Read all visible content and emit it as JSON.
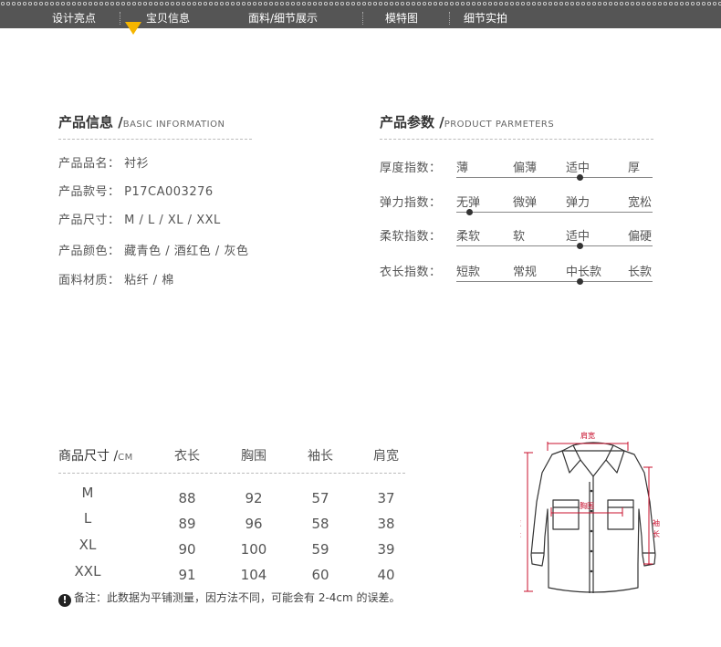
{
  "nav": {
    "items": [
      "设计亮点",
      "宝贝信息",
      "面料/细节展示",
      "模特图",
      "细节实拍"
    ],
    "active_index": 1,
    "background": "#555555",
    "active_color": "#f5b500"
  },
  "basic_info": {
    "title": "产品信息 /",
    "title_en": "BASIC INFORMATION",
    "rows": [
      {
        "label": "产品品名：",
        "value": "衬衫"
      },
      {
        "label": "产品款号：",
        "value": "P17CA003276"
      },
      {
        "label": "产品尺寸：",
        "value": "M / L / XL / XXL"
      },
      {
        "label": "产品颜色：",
        "value": "藏青色 / 酒红色 / 灰色"
      },
      {
        "label": "面料材质：",
        "value": "粘纤 / 棉"
      }
    ]
  },
  "params": {
    "title": "产品参数 /",
    "title_en": "PRODUCT PARMETERS",
    "rows": [
      {
        "label": "厚度指数：",
        "options": [
          "薄",
          "偏薄",
          "适中",
          "厚"
        ],
        "selected_index": 2
      },
      {
        "label": "弹力指数：",
        "options": [
          "无弹",
          "微弹",
          "弹力",
          "宽松"
        ],
        "selected_index": 0
      },
      {
        "label": "柔软指数：",
        "options": [
          "柔软",
          "软",
          "适中",
          "偏硬"
        ],
        "selected_index": 2
      },
      {
        "label": "衣长指数：",
        "options": [
          "短款",
          "常规",
          "中长款",
          "长款"
        ],
        "selected_index": 2
      }
    ]
  },
  "size_table": {
    "header_title": "商品尺寸 /",
    "header_unit": "CM",
    "columns": [
      "衣长",
      "胸围",
      "袖长",
      "肩宽"
    ],
    "rows": [
      {
        "size": "M",
        "values": [
          "88",
          "92",
          "57",
          "37"
        ]
      },
      {
        "size": "L",
        "values": [
          "89",
          "96",
          "58",
          "38"
        ]
      },
      {
        "size": "XL",
        "values": [
          "90",
          "100",
          "59",
          "39"
        ]
      },
      {
        "size": "XXL",
        "values": [
          "91",
          "104",
          "60",
          "40"
        ]
      }
    ]
  },
  "note": {
    "icon": "!",
    "text": "备注：此数据为平铺测量，因方法不同，可能会有 2-4cm 的误差。"
  },
  "diagram": {
    "shoulder_label": "肩宽",
    "chest_label": "胸围",
    "length_label": "衣长",
    "sleeve_label": "袖长",
    "measure_color": "#c8102e"
  }
}
